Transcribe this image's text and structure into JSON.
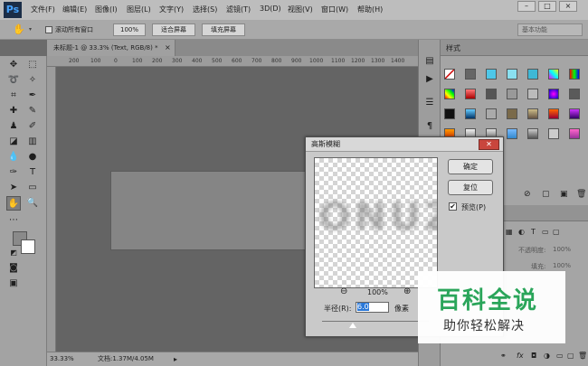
{
  "app": {
    "logo": "Ps"
  },
  "menu": [
    "文件(F)",
    "编辑(E)",
    "图像(I)",
    "图层(L)",
    "文字(Y)",
    "选择(S)",
    "滤镜(T)",
    "3D(D)",
    "视图(V)",
    "窗口(W)",
    "帮助(H)"
  ],
  "window_controls": {
    "minimize": "–",
    "restore": "□",
    "close": "×"
  },
  "options_bar": {
    "scroll_all_label": "滚动所有窗口",
    "zoom_100": "100%",
    "fit_screen": "适合屏幕",
    "fill_screen": "填充屏幕",
    "workspace": "基本功能"
  },
  "document_tab": {
    "title": "未标题-1 @ 33.3% (Text, RGB/8) *",
    "close": "×"
  },
  "ruler_ticks": [
    "200",
    "100",
    "0",
    "100",
    "200",
    "300",
    "400",
    "500",
    "600",
    "700",
    "800",
    "900",
    "1000",
    "1100",
    "1200",
    "1300",
    "1400"
  ],
  "status": {
    "zoom": "33.33%",
    "doc_info": "文档:1.37M/4.05M"
  },
  "styles_panel": {
    "tab_label": "样式"
  },
  "layers_panel": {
    "opacity_label": "不透明度:",
    "opacity_value": "100%",
    "fill_label": "填充:",
    "fill_value": "100%"
  },
  "dialog": {
    "title": "高斯模糊",
    "close": "✕",
    "ok_label": "确定",
    "reset_label": "复位",
    "preview_label": "预览(P)",
    "preview_checked": true,
    "zoom_level": "100%",
    "radius_label": "半径(R):",
    "radius_value": "6.0",
    "radius_unit": "像素",
    "preview_text": "ONUZ"
  },
  "watermark": {
    "title": "百科全说",
    "subtitle": "助你轻松解决"
  },
  "colors": {
    "accent_blue": "#2a78d8",
    "watermark_green": "#2aa55a",
    "close_red": "#c9463d"
  }
}
